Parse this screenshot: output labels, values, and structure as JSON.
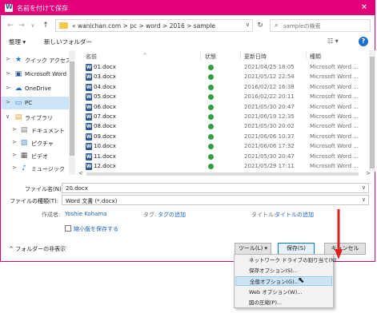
{
  "window": {
    "title": "名前を付けて保存",
    "close_glyph": "✕"
  },
  "address": {
    "back": "←",
    "forward": "→",
    "dropdown": "∨",
    "up": "↑",
    "crumbs": "« wanichan.com  >  pc  >  word  >  2016  >  sample",
    "refresh": "↻",
    "search_placeholder": "sampleの検索"
  },
  "toolbar": {
    "organize": "整理 ▾",
    "new_folder": "新しいフォルダー",
    "view_glyph": "☷ ▾",
    "help": "?"
  },
  "nav": {
    "items": [
      {
        "label": "クイック アクセス",
        "arrow": ">",
        "icon": "★",
        "icon_color": "#1f6fd1",
        "name": "quick-access"
      },
      {
        "label": "Microsoft Word",
        "arrow": ">",
        "icon": "▣",
        "icon_color": "#2b579a",
        "name": "microsoft-word"
      },
      {
        "label": "OneDrive",
        "arrow": ">",
        "icon": "☁",
        "icon_color": "#1f6fd1",
        "name": "onedrive"
      },
      {
        "label": "PC",
        "arrow": ">",
        "icon": "▭",
        "icon_color": "#3a7bd5",
        "name": "pc",
        "selected": true
      },
      {
        "label": "ライブラリ",
        "arrow": "∨",
        "icon": "▤",
        "icon_color": "#e0a030",
        "name": "library"
      },
      {
        "label": "ドキュメント",
        "arrow": ">",
        "icon": "▤",
        "icon_color": "#777777",
        "name": "documents",
        "sub": true
      },
      {
        "label": "ピクチャ",
        "arrow": ">",
        "icon": "▨",
        "icon_color": "#4a8fd4",
        "name": "pictures",
        "sub": true
      },
      {
        "label": "ビデオ",
        "arrow": ">",
        "icon": "▦",
        "icon_color": "#555555",
        "name": "videos",
        "sub": true
      },
      {
        "label": "ミュージック",
        "arrow": ">",
        "icon": "♪",
        "icon_color": "#1f6fd1",
        "name": "music",
        "sub": true
      }
    ]
  },
  "columns": {
    "name": "名前",
    "status": "状態",
    "date": "更新日時",
    "type": "種類"
  },
  "files": [
    {
      "name": "01.docx",
      "date": "2021/04/25 18:05",
      "type": "Microsoft Word ..."
    },
    {
      "name": "03.docx",
      "date": "2021/05/12 22:54",
      "type": "Microsoft Word ..."
    },
    {
      "name": "04.docx",
      "date": "2016/02/12 16:38",
      "type": "Microsoft Word ..."
    },
    {
      "name": "05.docx",
      "date": "2016/02/22 20:11",
      "type": "Microsoft Word ..."
    },
    {
      "name": "06.docx",
      "date": "2021/05/30 20:47",
      "type": "Microsoft Word ..."
    },
    {
      "name": "07.docx",
      "date": "2021/06/19 12:35",
      "type": "Microsoft Word ..."
    },
    {
      "name": "08.docx",
      "date": "2021/05/30 20:02",
      "type": "Microsoft Word ..."
    },
    {
      "name": "09.docx",
      "date": "2021/06/06 10:37",
      "type": "Microsoft Word ..."
    },
    {
      "name": "10.docx",
      "date": "2021/06/06 17:32",
      "type": "Microsoft Word ..."
    },
    {
      "name": "11.docx",
      "date": "2021/05/30 20:47",
      "type": "Microsoft Word ..."
    },
    {
      "name": "12.docx",
      "date": "2021/05/29 17:11",
      "type": "Microsoft Word ..."
    }
  ],
  "form": {
    "filename_label": "ファイル名(N):",
    "filename_value": "20.docx",
    "filetype_label": "ファイルの種類(T):",
    "filetype_value": "Word 文書 (*.docx)",
    "author_label": "作成者:",
    "author_value": "Yoshie Kohama",
    "tags_label": "タグ:",
    "tags_value": "タグの追加",
    "title_label": "タイトル:",
    "title_value": "タイトルの追加",
    "thumbnail_label": "縮小版を保存する"
  },
  "footer": {
    "hide_folders": "^  フォルダーの非表示",
    "tools": "ツール(L)  ▾",
    "save": "保存(S)",
    "cancel": "キャンセル"
  },
  "tools_menu": [
    {
      "label": "ネットワーク ドライブの割り当て(N)...",
      "name": "map-network-drive"
    },
    {
      "label": "保存オプション(S)...",
      "name": "save-options"
    },
    {
      "label": "全般オプション(G)...",
      "name": "general-options",
      "hover": true
    },
    {
      "label": "Web オプション(W)...",
      "name": "web-options"
    },
    {
      "label": "図の圧縮(P)...",
      "name": "compress-pictures"
    }
  ],
  "colors": {
    "accent": "#e2007a",
    "annotation_arrow": "#e0201c",
    "status_ok": "#2ea043"
  }
}
